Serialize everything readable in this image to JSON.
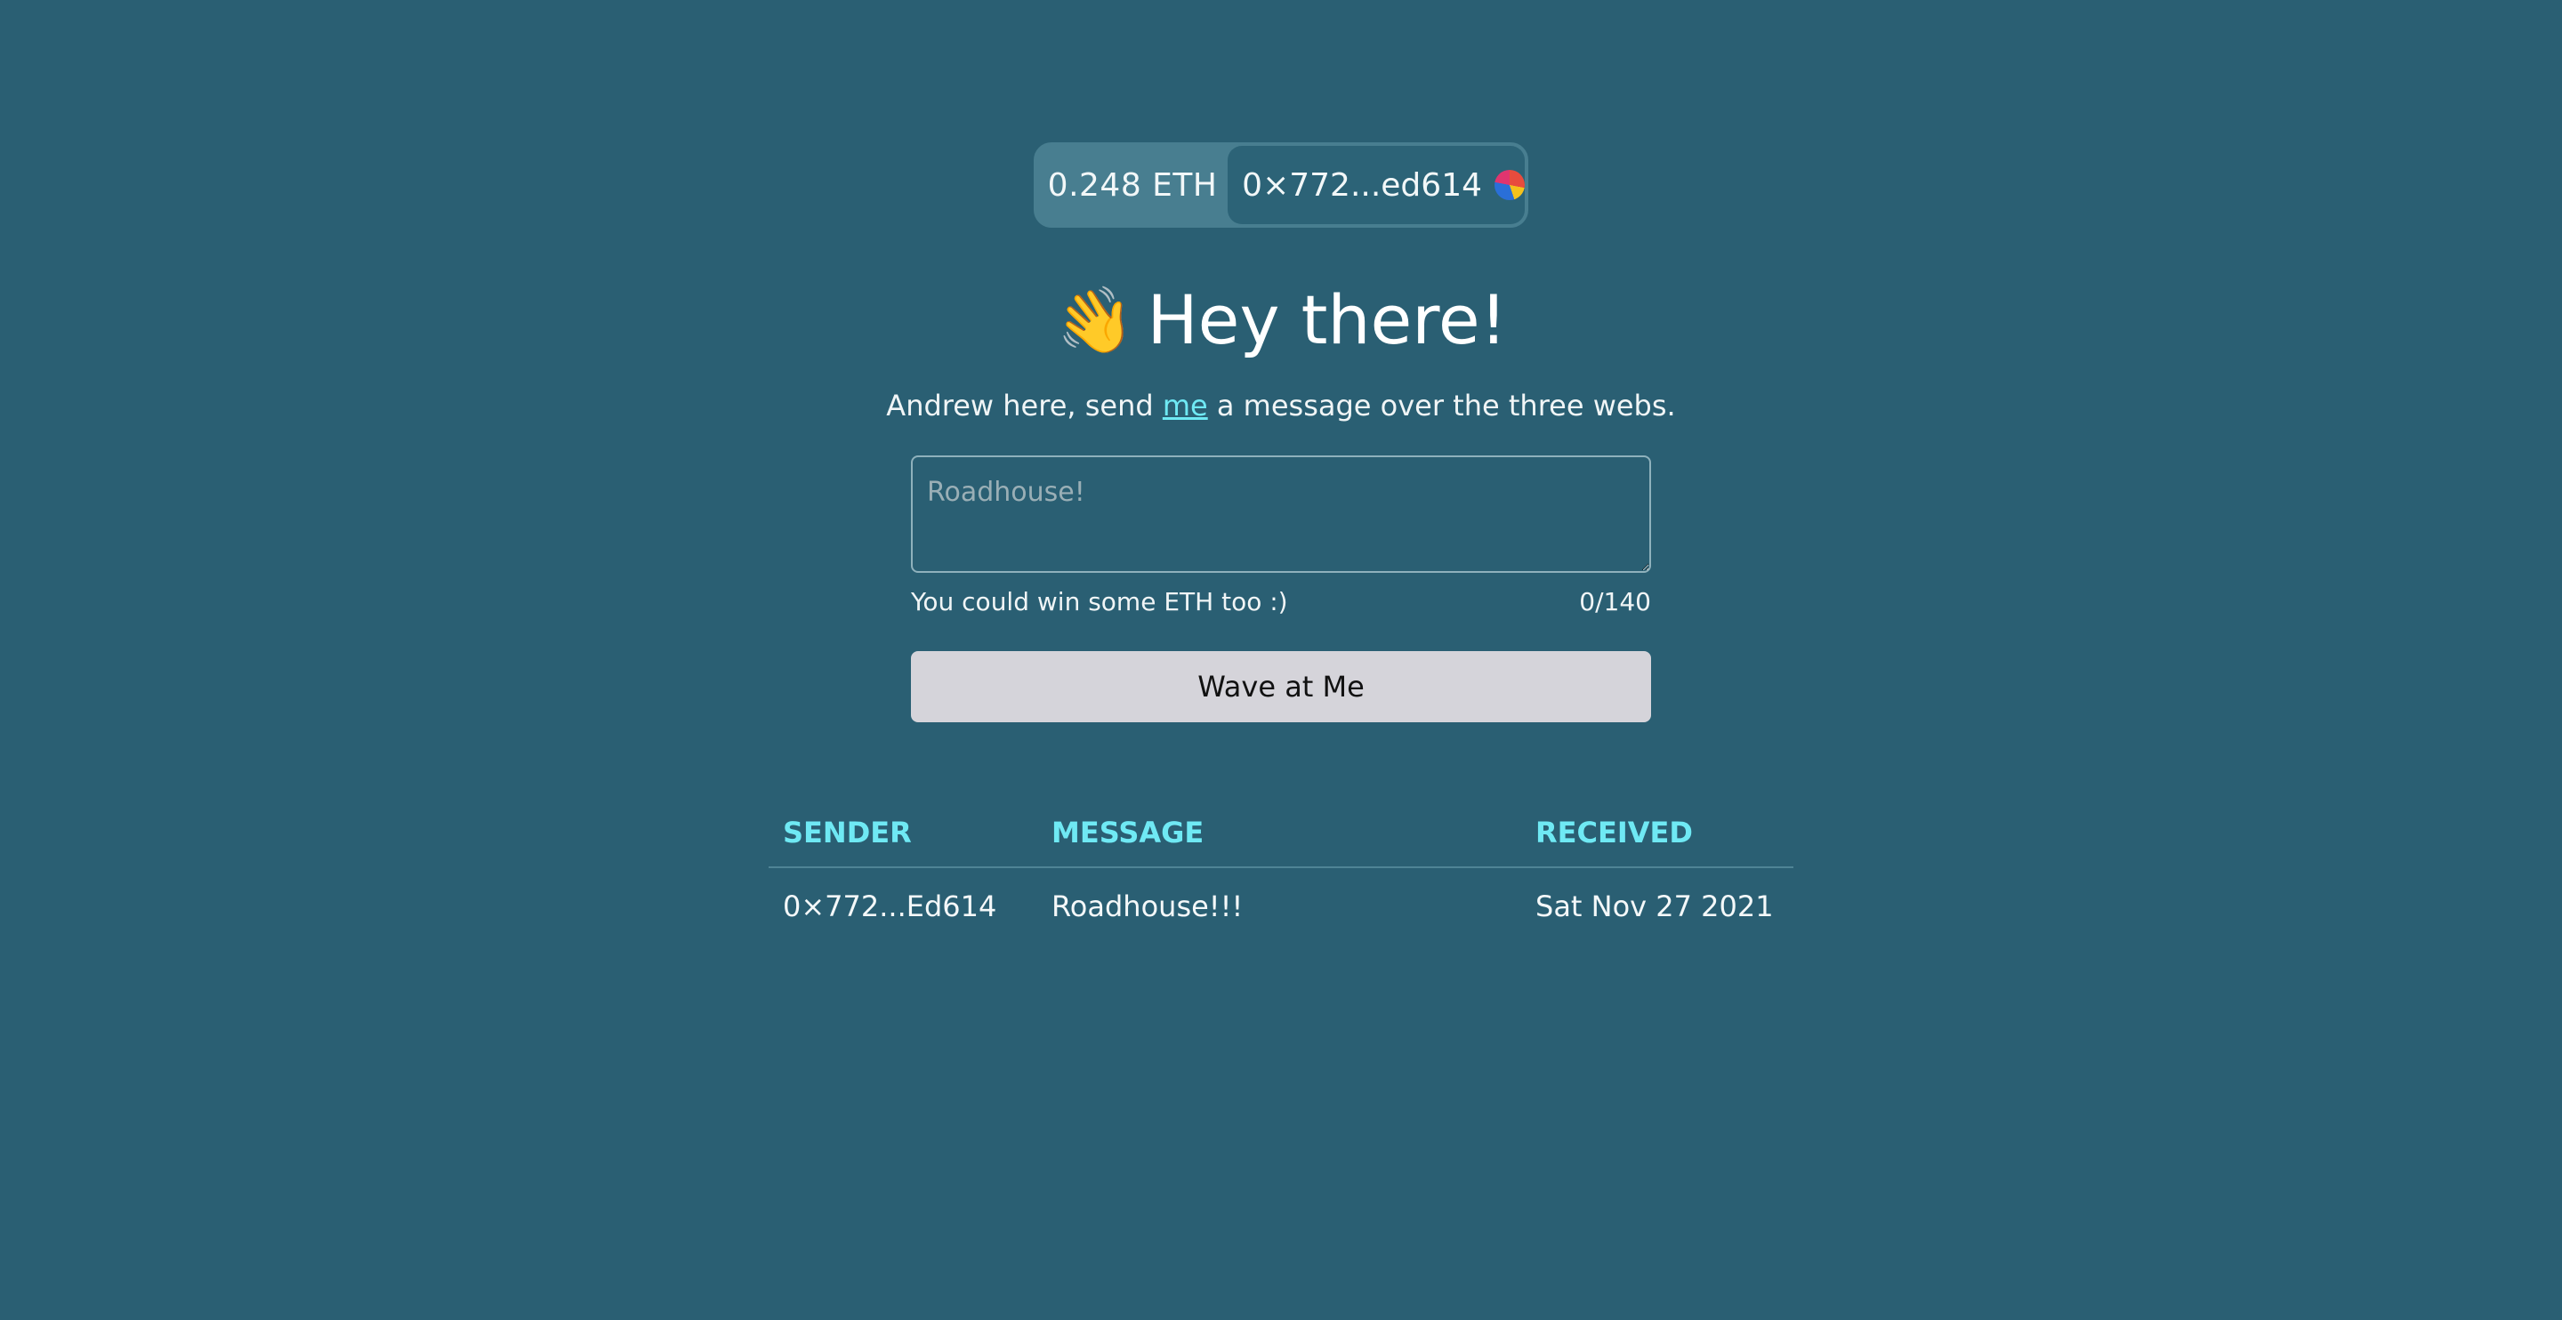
{
  "wallet": {
    "balance": "0.248 ETH",
    "account": "0×772...ed614",
    "avatar_icon": "account-avatar-icon"
  },
  "heading": {
    "emoji": "👋",
    "title": "Hey there!"
  },
  "intro": {
    "before_link": "Andrew here, send ",
    "link_text": "me",
    "after_link": " a message over the three webs."
  },
  "form": {
    "message_placeholder": "Roadhouse!",
    "message_value": "",
    "hint": "You could win some ETH too :)",
    "char_count": "0/140",
    "submit_label": "Wave at Me"
  },
  "waves_table": {
    "headers": {
      "sender": "SENDER",
      "message": "MESSAGE",
      "received": "RECEIVED"
    },
    "rows": [
      {
        "sender": "0×772...Ed614",
        "message": "Roadhouse!!!",
        "received": "Sat Nov 27 2021"
      }
    ]
  },
  "colors": {
    "background": "#2a5f73",
    "accent": "#6fe9f4",
    "button": "#d5d4da"
  }
}
